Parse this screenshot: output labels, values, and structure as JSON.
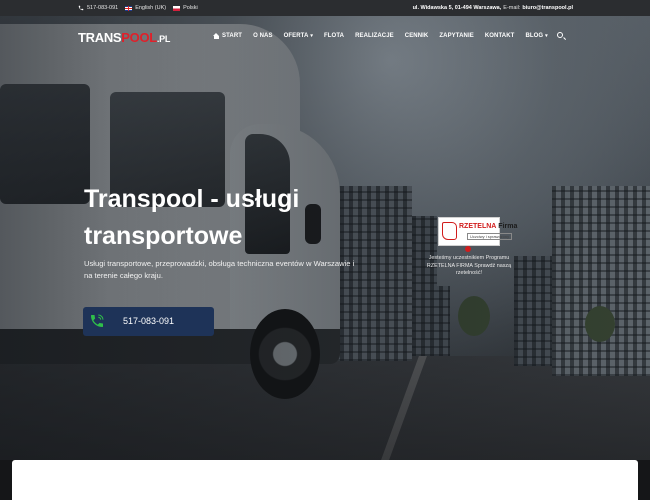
{
  "topbar": {
    "phone": "517-083-091",
    "lang_en": "English (UK)",
    "lang_pl": "Polski",
    "address": "ul. Widawska 5, 01-494 Warszawa,",
    "email_label": "E-mail:",
    "email": "biuro@transpool.pl"
  },
  "logo": {
    "part1": "TRANS",
    "part2": "POOL",
    "part3": ".PL"
  },
  "nav": {
    "items": [
      {
        "label": "START"
      },
      {
        "label": "O NAS"
      },
      {
        "label": "OFERTA"
      },
      {
        "label": "FLOTA"
      },
      {
        "label": "REALIZACJE"
      },
      {
        "label": "CENNIK"
      },
      {
        "label": "ZAPYTANIE"
      },
      {
        "label": "KONTAKT"
      },
      {
        "label": "BLOG"
      }
    ]
  },
  "hero": {
    "title": "Transpool - usługi transportowe",
    "description": "Usługi transportowe, przeprowadzki, obsługa techniczna eventów w Warszawie i na terenie całego kraju.",
    "call_number": "517-083-091"
  },
  "badge": {
    "title_red": "RZETELNA",
    "title_dark": " Firma",
    "subtitle": "Uczciwy i sprawdzony",
    "text": "Jesteśmy uczestnikiem Programu RZETELNA FIRMA Sprawdź naszą rzetelność!"
  },
  "colors": {
    "topbar_bg": "#2b2d30",
    "accent_red": "#e0202a",
    "call_button_bg": "#1e3358",
    "call_icon": "#2fbf4a"
  }
}
